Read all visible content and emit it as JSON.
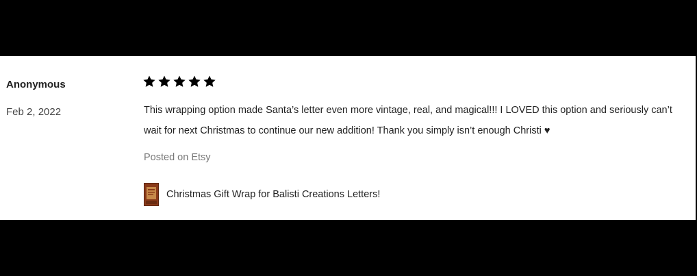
{
  "review": {
    "reviewer": "Anonymous",
    "date": "Feb 2, 2022",
    "rating": 5,
    "rating_max": 5,
    "star_color": "#000000",
    "text": "This wrapping option made Santa’s letter even more vintage, real, and magical!!! I LOVED this option and seriously can’t wait for next Christmas to continue our new addition! Thank you simply isn’t enough Christi ♥",
    "source": "Posted on Etsy",
    "item": {
      "title": "Christmas Gift Wrap for Balisti Creations Letters!",
      "thumbnail_colors": [
        "#8a3a1a",
        "#c7894a",
        "#5a2410"
      ]
    }
  }
}
